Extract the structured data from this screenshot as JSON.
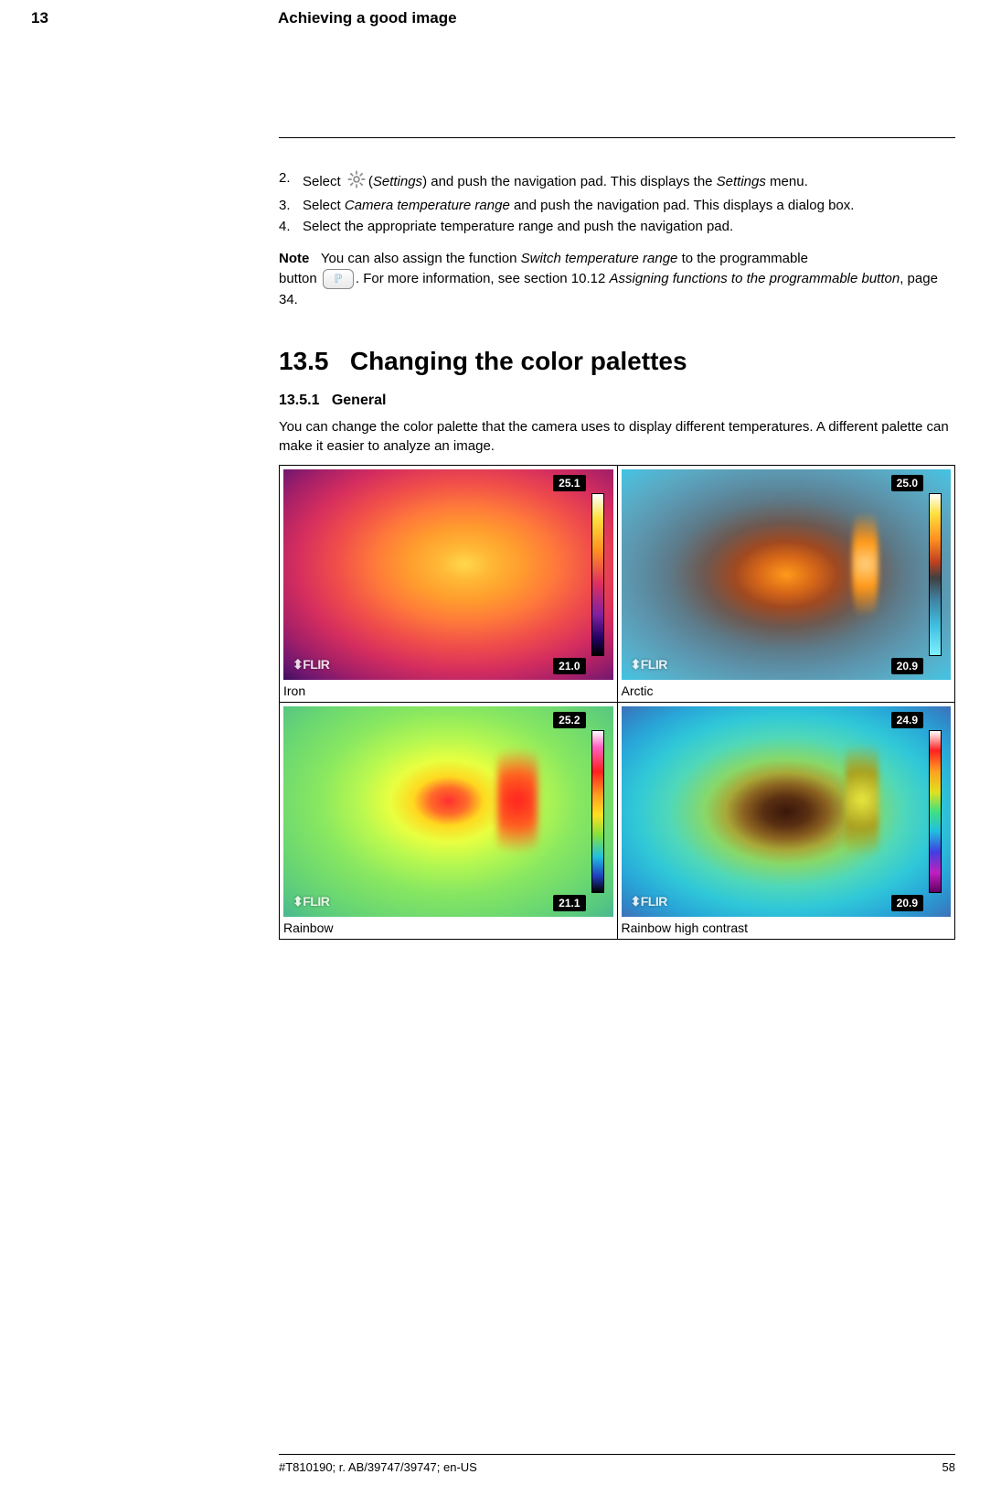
{
  "header": {
    "chapter_num": "13",
    "chapter_title": "Achieving a good image"
  },
  "steps": {
    "s2": {
      "num": "2.",
      "pre": "Select ",
      "icon_label_open": "(",
      "icon_label": "Settings",
      "icon_label_close": ")",
      "post_a": " and push the navigation pad. This displays the ",
      "post_b": "Settings",
      "post_c": " menu."
    },
    "s3": {
      "num": "3.",
      "pre": "Select ",
      "em": "Camera temperature range",
      "post": " and push the navigation pad. This displays a dialog box."
    },
    "s4": {
      "num": "4.",
      "text": "Select the appropriate temperature range and push the navigation pad."
    }
  },
  "note": {
    "label": "Note",
    "line1_a": "You can also assign the function ",
    "line1_b": "Switch temperature range",
    "line1_c": " to the programmable",
    "line2_a": "button ",
    "line2_b": ". For more information, see section 10.12 ",
    "line2_c": "Assigning functions to the programmable button",
    "line2_d": ", page 34."
  },
  "section": {
    "num": "13.5",
    "title": "Changing the color palettes",
    "sub_num": "13.5.1",
    "sub_title": "General",
    "para": "You can change the color palette that the camera uses to display different temperatures. A different palette can make it easier to analyze an image."
  },
  "palettes": {
    "flir": "⬍FLIR",
    "iron": {
      "caption": "Iron",
      "top": "25.1",
      "bot": "21.0"
    },
    "arctic": {
      "caption": "Arctic",
      "top": "25.0",
      "bot": "20.9"
    },
    "rainbow": {
      "caption": "Rainbow",
      "top": "25.2",
      "bot": "21.1"
    },
    "rainbow_hc": {
      "caption": "Rainbow high contrast",
      "top": "24.9",
      "bot": "20.9"
    }
  },
  "footer": {
    "doc_id": "#T810190; r. AB/39747/39747; en-US",
    "page": "58"
  },
  "p_button_glyph": "ℙ"
}
